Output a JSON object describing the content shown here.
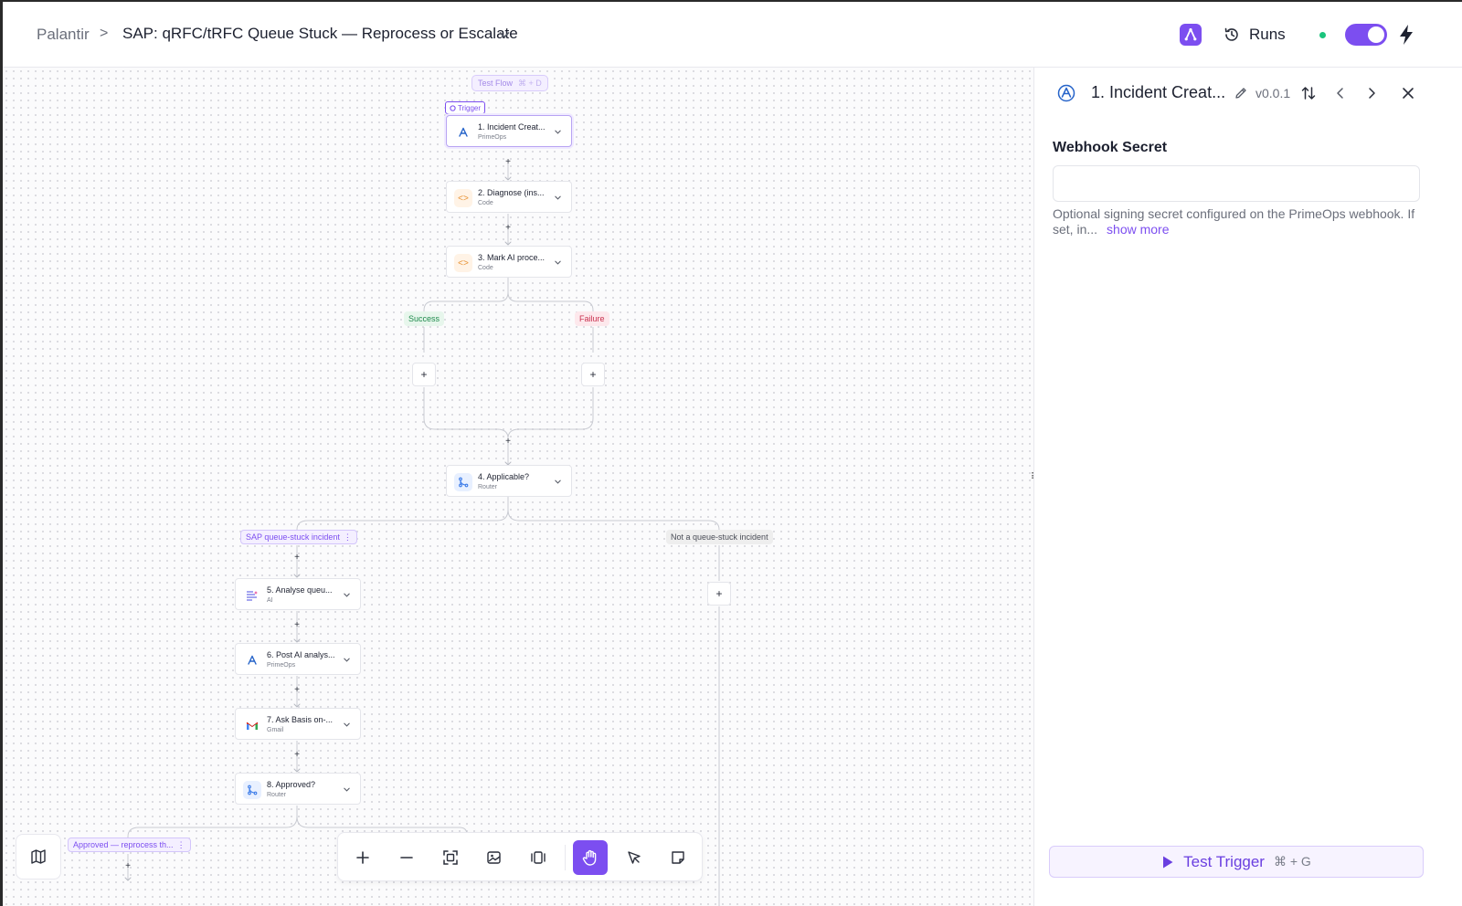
{
  "header": {
    "breadcrumb_root": "Palantir",
    "breadcrumb_sep": ">",
    "flow_title": "SAP: qRFC/tRFC Queue Stuck — Reprocess or Escalate",
    "runs_label": "Runs",
    "published_toggle": true,
    "status_color": "#1bc47d"
  },
  "canvas": {
    "test_flow_label": "Test Flow",
    "test_flow_shortcut": "⌘ + D",
    "trigger_tag": "Trigger",
    "nodes": [
      {
        "title": "1. Incident Creat...",
        "subtitle": "PrimeOps",
        "icon": "primeops-icon"
      },
      {
        "title": "2. Diagnose (ins...",
        "subtitle": "Code",
        "icon": "code-icon"
      },
      {
        "title": "3. Mark AI proce...",
        "subtitle": "Code",
        "icon": "code-icon"
      },
      {
        "title": "4. Applicable?",
        "subtitle": "Router",
        "icon": "router-icon"
      },
      {
        "title": "5. Analyse queu...",
        "subtitle": "AI",
        "icon": "ai-icon"
      },
      {
        "title": "6. Post AI analys...",
        "subtitle": "PrimeOps",
        "icon": "primeops-icon"
      },
      {
        "title": "7. Ask Basis on-...",
        "subtitle": "Gmail",
        "icon": "gmail-icon"
      },
      {
        "title": "8. Approved?",
        "subtitle": "Router",
        "icon": "router-icon"
      }
    ],
    "branches": {
      "success": "Success",
      "failure": "Failure",
      "route_sap": "SAP queue-stuck incident",
      "route_other": "Not a queue-stuck incident",
      "route_approved": "Approved — reprocess th..."
    },
    "plus": "+",
    "colors": {
      "accent": "#7c4ef0",
      "success": "#1f8a4c",
      "failure": "#c9304e"
    }
  },
  "panel": {
    "title": "1. Incident Creat...",
    "version": "v0.0.1",
    "field_label": "Webhook Secret",
    "field_value": "",
    "field_help": "Optional signing secret configured on the PrimeOps webhook. If set, in...",
    "show_more": "show more",
    "test_button": "Test Trigger",
    "test_shortcut": "⌘ + G"
  }
}
